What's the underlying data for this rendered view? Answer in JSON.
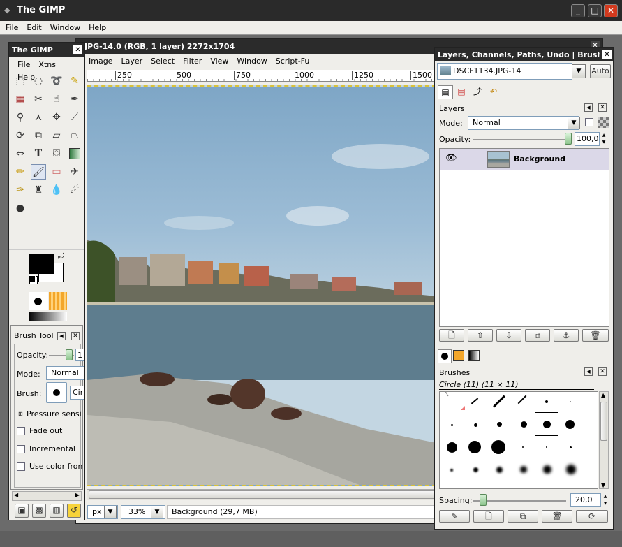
{
  "window": {
    "title": "The GIMP"
  },
  "main_menu": [
    "File",
    "Edit",
    "Window",
    "Help"
  ],
  "image_window": {
    "title": "JPG-14.0 (RGB, 1 layer) 2272x1704",
    "menus": [
      "Image",
      "Layer",
      "Select",
      "Filter",
      "View",
      "Window",
      "Script-Fu"
    ],
    "ruler": [
      "250",
      "500",
      "750",
      "1000",
      "1250",
      "1500"
    ],
    "unit": "px",
    "zoom": "33%",
    "status": "Background (29,7 MB)"
  },
  "toolbox": {
    "title": "The GIMP",
    "menus": [
      "File",
      "Xtns",
      "Help"
    ],
    "fg_color": "#000000",
    "bg_color": "#ffffff"
  },
  "tool_options": {
    "title": "Brush Tool",
    "opacity_label": "Opacity:",
    "opacity_value": "1",
    "mode_label": "Mode:",
    "mode_value": "Normal",
    "brush_label": "Brush:",
    "brush_name": "Cir",
    "pressure": "Pressure sensit",
    "fade": "Fade out",
    "incremental": "Incremental",
    "use_color": "Use color from"
  },
  "dock": {
    "title": "Layers, Channels, Paths, Undo | Brushes...",
    "image_select": "DSCF1134.JPG-14",
    "auto_button": "Auto",
    "layers": {
      "title": "Layers",
      "mode_label": "Mode:",
      "mode_value": "Normal",
      "opacity_label": "Opacity:",
      "opacity_value": "100,0",
      "layer_name": "Background"
    },
    "brushes": {
      "title": "Brushes",
      "current": "Circle (11) (11 × 11)",
      "spacing_label": "Spacing:",
      "spacing_value": "20,0"
    }
  }
}
